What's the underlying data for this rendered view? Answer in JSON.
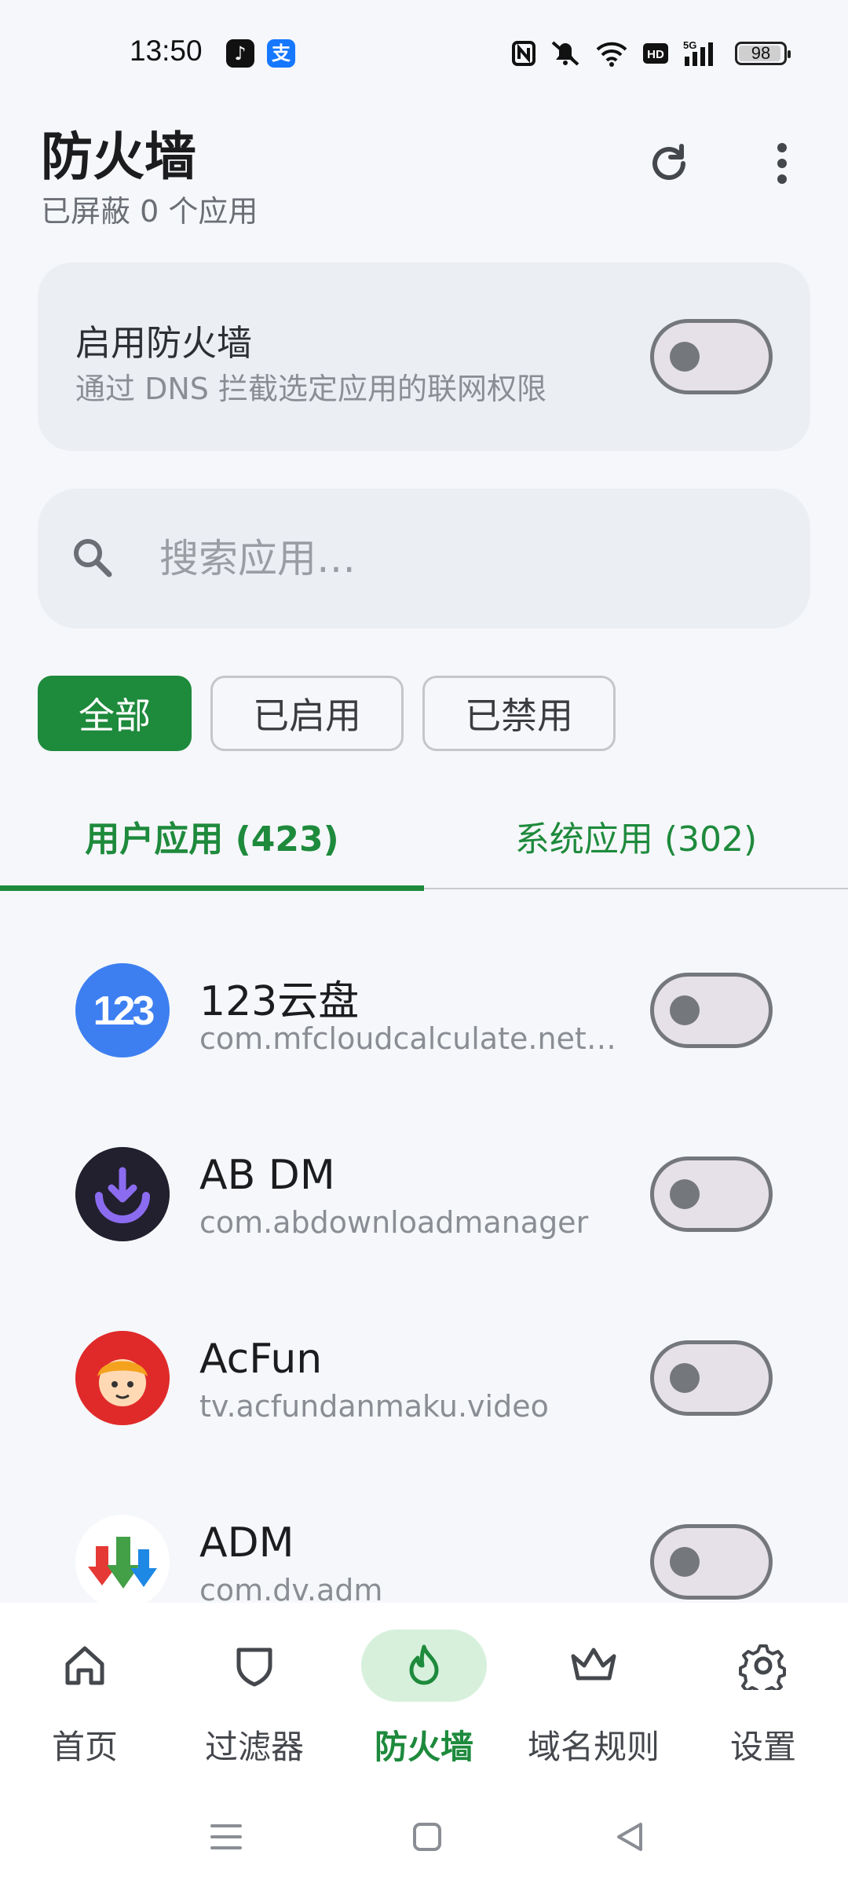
{
  "status_bar": {
    "time": "13:50",
    "battery": "98",
    "apps": [
      {
        "name": "tiktok-icon",
        "glyph": "♪",
        "color": "#111111"
      },
      {
        "name": "alipay-icon",
        "glyph": "支",
        "color": "#1677ff"
      }
    ]
  },
  "header": {
    "title": "防火墙",
    "subtitle": "已屏蔽 0 个应用",
    "refresh_icon": "refresh-icon",
    "more_icon": "more-vert-icon"
  },
  "firewall_card": {
    "title": "启用防火墙",
    "description": "通过 DNS 拦截选定应用的联网权限",
    "enabled": false
  },
  "search": {
    "placeholder": "搜索应用…"
  },
  "filters": [
    {
      "label": "全部",
      "active": true
    },
    {
      "label": "已启用",
      "active": false
    },
    {
      "label": "已禁用",
      "active": false
    }
  ],
  "tabs": [
    {
      "label": "用户应用 (423)",
      "active": true
    },
    {
      "label": "系统应用 (302)",
      "active": false
    }
  ],
  "apps": [
    {
      "name": "123云盘",
      "package": "com.mfcloudcalculate.networkdisk",
      "enabled": false
    },
    {
      "name": "AB DM",
      "package": "com.abdownloadmanager",
      "enabled": false
    },
    {
      "name": "AcFun",
      "package": "tv.acfundanmaku.video",
      "enabled": false
    },
    {
      "name": "ADM",
      "package": "com.dv.adm",
      "enabled": false
    }
  ],
  "bottom_nav": [
    {
      "label": "首页",
      "icon": "home-icon",
      "active": false
    },
    {
      "label": "过滤器",
      "icon": "shield-icon",
      "active": false
    },
    {
      "label": "防火墙",
      "icon": "fire-icon",
      "active": true
    },
    {
      "label": "域名规则",
      "icon": "crown-icon",
      "active": false
    },
    {
      "label": "设置",
      "icon": "gear-icon",
      "active": false
    }
  ],
  "colors": {
    "accent": "#1e8a3c",
    "background": "#f5f7fa",
    "card": "#ebeef2"
  }
}
